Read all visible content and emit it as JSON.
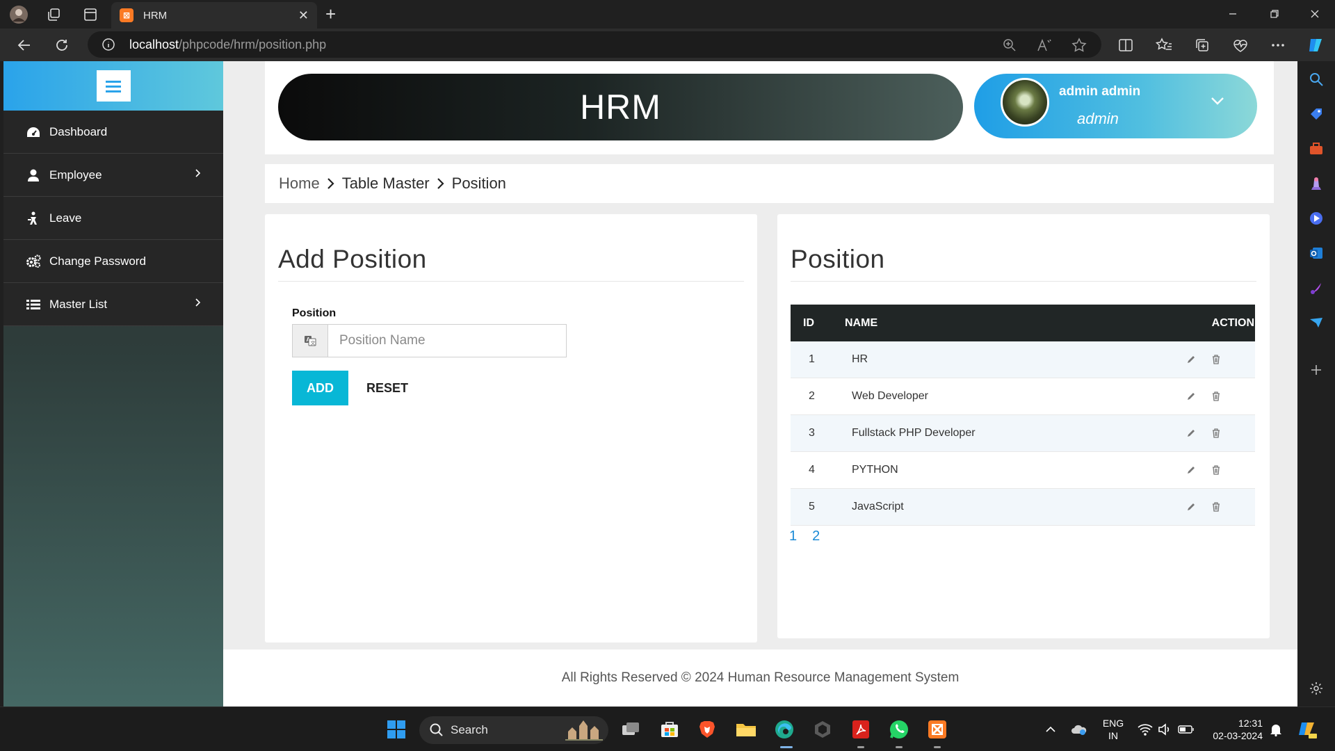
{
  "browser": {
    "tab_title": "HRM",
    "tab_favicon": "xampp-icon",
    "url_host": "localhost",
    "url_path": "/phpcode/hrm/position.php"
  },
  "sidebar": {
    "items": [
      {
        "label": "Dashboard",
        "icon": "dashboard-icon",
        "has_submenu": false
      },
      {
        "label": "Employee",
        "icon": "user-icon",
        "has_submenu": true
      },
      {
        "label": "Leave",
        "icon": "leave-icon",
        "has_submenu": false
      },
      {
        "label": "Change Password",
        "icon": "gears-icon",
        "has_submenu": false
      },
      {
        "label": "Master List",
        "icon": "list-icon",
        "has_submenu": true
      }
    ]
  },
  "header": {
    "brand": "HRM",
    "user_name": "admin admin",
    "user_role": "admin"
  },
  "breadcrumb": [
    "Home",
    "Table Master",
    "Position"
  ],
  "add_form": {
    "title": "Add Position",
    "field_label": "Position",
    "placeholder": "Position Name",
    "value": "",
    "add_label": "ADD",
    "reset_label": "RESET"
  },
  "position_table": {
    "title": "Position",
    "columns": [
      "ID",
      "NAME",
      "ACTION"
    ],
    "rows": [
      {
        "id": "1",
        "name": "HR"
      },
      {
        "id": "2",
        "name": "Web Developer"
      },
      {
        "id": "3",
        "name": "Fullstack PHP Developer"
      },
      {
        "id": "4",
        "name": "PYTHON"
      },
      {
        "id": "5",
        "name": "JavaScript"
      }
    ],
    "pages": [
      "1",
      "2"
    ]
  },
  "footer": {
    "text": "All Rights Reserved © 2024 Human Resource Management System"
  },
  "taskbar": {
    "search_label": "Search",
    "lang_top": "ENG",
    "lang_bottom": "IN",
    "time": "12:31",
    "date": "02-03-2024"
  },
  "colors": {
    "accent_cyan": "#08b7d6",
    "sidebar_header": "#2aa3ea",
    "table_header": "#212626",
    "link_blue": "#1a8ad6"
  }
}
